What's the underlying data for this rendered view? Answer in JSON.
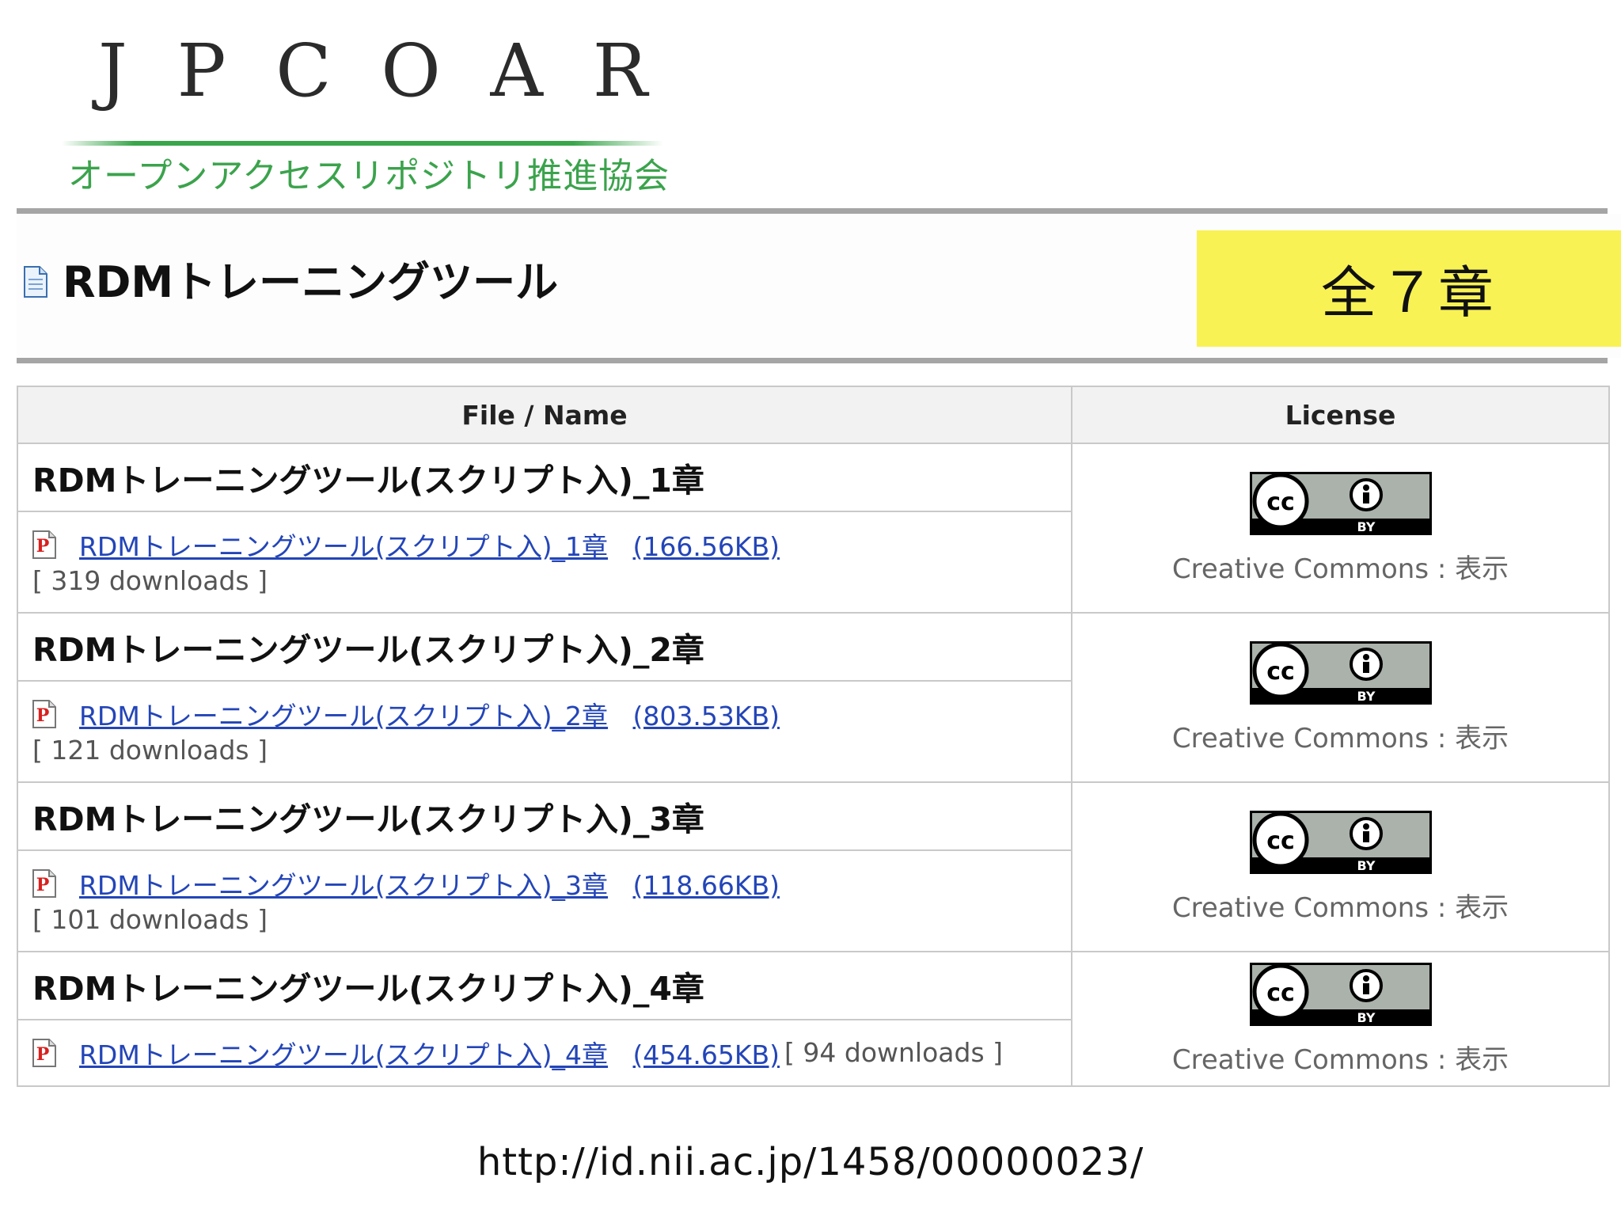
{
  "logo": {
    "wordmark": [
      "J",
      "P",
      "C",
      "O",
      "A",
      "R"
    ],
    "subtitle": "オープンアクセスリポジトリ推進協会",
    "line_color": "#3aa64c",
    "subtitle_color": "#3ba34c"
  },
  "header": {
    "title": "RDMトレーニングツール",
    "badge": "全７章",
    "badge_color": "#f8f254",
    "title_icon": "document-icon"
  },
  "table": {
    "columns": [
      "File / Name",
      "License"
    ],
    "rows": [
      {
        "title": "RDMトレーニングツール(スクリプト入)_1章",
        "file_name": "RDMトレーニングツール(スクリプト入)_1章",
        "file_size": "(166.56KB)",
        "downloads": "[ 319 downloads ]",
        "license": "Creative Commons : 表示",
        "icon": "pdf-icon",
        "license_icon": "cc-by-icon"
      },
      {
        "title": "RDMトレーニングツール(スクリプト入)_2章",
        "file_name": "RDMトレーニングツール(スクリプト入)_2章",
        "file_size": "(803.53KB)",
        "downloads": "[ 121 downloads ]",
        "license": "Creative Commons : 表示",
        "icon": "pdf-icon",
        "license_icon": "cc-by-icon"
      },
      {
        "title": "RDMトレーニングツール(スクリプト入)_3章",
        "file_name": "RDMトレーニングツール(スクリプト入)_3章",
        "file_size": "(118.66KB)",
        "downloads": "[ 101 downloads ]",
        "license": "Creative Commons : 表示",
        "icon": "pdf-icon",
        "license_icon": "cc-by-icon"
      },
      {
        "title": "RDMトレーニングツール(スクリプト入)_4章",
        "file_name": "RDMトレーニングツール(スクリプト入)_4章",
        "file_size": "(454.65KB)",
        "downloads": "[ 94 downloads ]",
        "license": "Creative Commons : 表示",
        "icon": "pdf-icon",
        "license_icon": "cc-by-icon"
      }
    ],
    "cc_badge": {
      "cc_label": "cc",
      "by_label": "BY"
    },
    "link_color": "#2345b8"
  },
  "footer": {
    "url": "http://id.nii.ac.jp/1458/00000023/"
  }
}
